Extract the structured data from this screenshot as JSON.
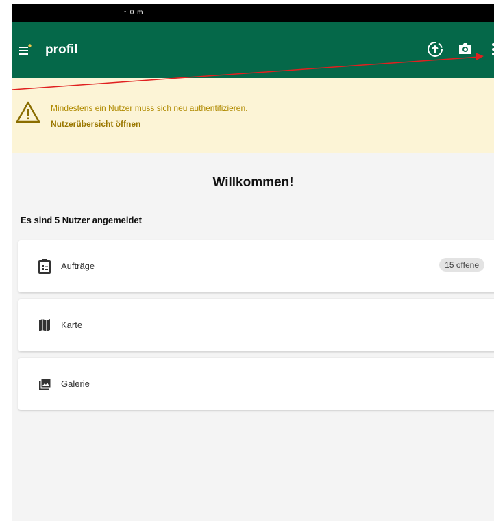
{
  "status_bar": {
    "text": "↑ 0 m"
  },
  "app_bar": {
    "title": "profil",
    "menu_icon": "menu-icon",
    "actions": [
      "upload-icon",
      "camera-icon",
      "more-vert-icon"
    ]
  },
  "warning": {
    "message": "Mindestens ein Nutzer muss sich neu authentifizieren.",
    "link": "Nutzerübersicht öffnen",
    "icon": "warning-icon"
  },
  "welcome": {
    "title": "Willkommen!",
    "users_text": "Es sind 5 Nutzer angemeldet"
  },
  "menu": {
    "items": [
      {
        "label": "Aufträge",
        "icon": "clipboard-icon",
        "badge": "15 offene"
      },
      {
        "label": "Karte",
        "icon": "map-icon"
      },
      {
        "label": "Galerie",
        "icon": "gallery-icon"
      }
    ]
  },
  "colors": {
    "app_bar": "#056849",
    "warning_background": "#fcf4d6",
    "warning_text": "#b08a00",
    "annotation_arrow": "#e02020"
  }
}
